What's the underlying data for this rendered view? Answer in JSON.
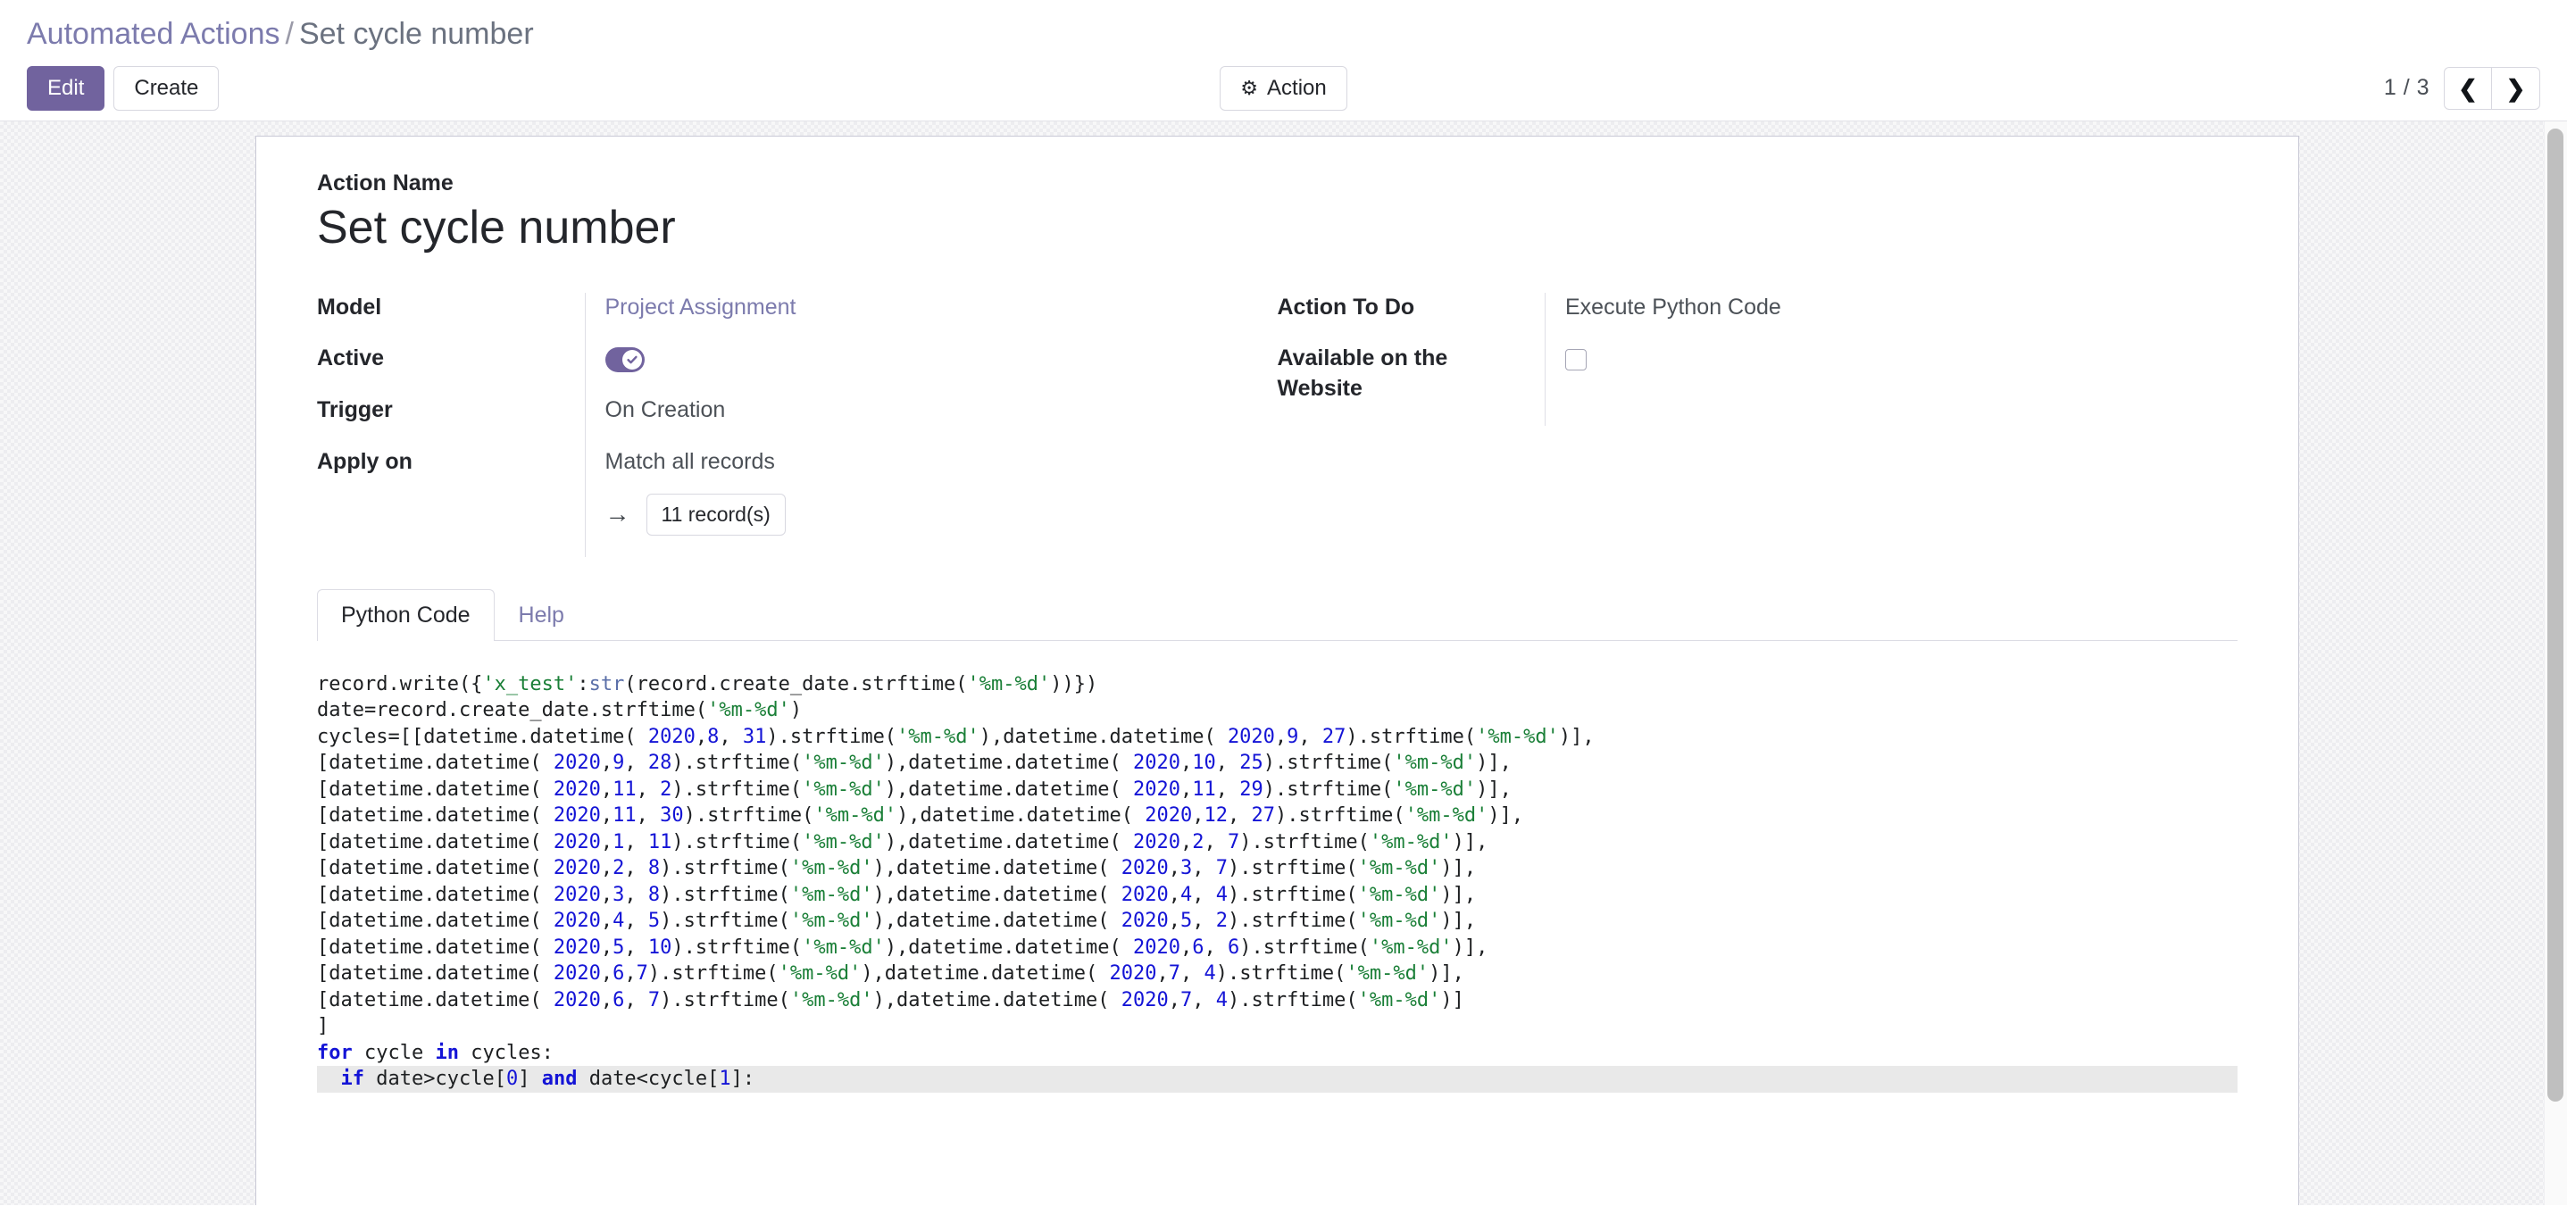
{
  "breadcrumb": {
    "root": "Automated Actions",
    "separator": "/",
    "leaf": "Set cycle number"
  },
  "toolbar": {
    "edit_label": "Edit",
    "create_label": "Create",
    "action_label": "Action",
    "action_icon": "gear-icon"
  },
  "pager": {
    "label": "1 / 3",
    "prev_icon": "❮",
    "next_icon": "❯",
    "current": 1,
    "total": 3
  },
  "form": {
    "name_label": "Action Name",
    "name_value": "Set cycle number",
    "left_fields": [
      {
        "label": "Model",
        "value": "Project Assignment",
        "type": "link"
      },
      {
        "label": "Active",
        "value": "",
        "type": "toggle",
        "checked": true
      },
      {
        "label": "Trigger",
        "value": "On Creation",
        "type": "text"
      },
      {
        "label": "Apply on",
        "value": "Match all records",
        "type": "text"
      }
    ],
    "right_fields": [
      {
        "label": "Action To Do",
        "value": "Execute Python Code",
        "type": "text"
      },
      {
        "label": "Available on the Website",
        "value": "",
        "type": "checkbox",
        "checked": false
      }
    ],
    "records": {
      "arrow_icon": "→",
      "button_label": "11 record(s)",
      "count": 11
    }
  },
  "notebook": {
    "tabs": [
      {
        "label": "Python Code",
        "active": true
      },
      {
        "label": "Help",
        "active": false
      }
    ]
  },
  "code": {
    "language": "python",
    "lines": [
      [
        {
          "t": "record.write({",
          "c": "plain"
        },
        {
          "t": "'x_test'",
          "c": "str"
        },
        {
          "t": ":",
          "c": "plain"
        },
        {
          "t": "str",
          "c": "fn"
        },
        {
          "t": "(record.create_date.strftime(",
          "c": "plain"
        },
        {
          "t": "'%m-%d'",
          "c": "str"
        },
        {
          "t": "))})",
          "c": "plain"
        }
      ],
      [
        {
          "t": "date=record.create_date.strftime(",
          "c": "plain"
        },
        {
          "t": "'%m-%d'",
          "c": "str"
        },
        {
          "t": ")",
          "c": "plain"
        }
      ],
      [
        {
          "t": "cycles=[[datetime.datetime( ",
          "c": "plain"
        },
        {
          "t": "2020",
          "c": "num"
        },
        {
          "t": ",",
          "c": "plain"
        },
        {
          "t": "8",
          "c": "num"
        },
        {
          "t": ", ",
          "c": "plain"
        },
        {
          "t": "31",
          "c": "num"
        },
        {
          "t": ").strftime(",
          "c": "plain"
        },
        {
          "t": "'%m-%d'",
          "c": "str"
        },
        {
          "t": "),datetime.datetime( ",
          "c": "plain"
        },
        {
          "t": "2020",
          "c": "num"
        },
        {
          "t": ",",
          "c": "plain"
        },
        {
          "t": "9",
          "c": "num"
        },
        {
          "t": ", ",
          "c": "plain"
        },
        {
          "t": "27",
          "c": "num"
        },
        {
          "t": ").strftime(",
          "c": "plain"
        },
        {
          "t": "'%m-%d'",
          "c": "str"
        },
        {
          "t": ")],",
          "c": "plain"
        }
      ],
      [
        {
          "t": "[datetime.datetime( ",
          "c": "plain"
        },
        {
          "t": "2020",
          "c": "num"
        },
        {
          "t": ",",
          "c": "plain"
        },
        {
          "t": "9",
          "c": "num"
        },
        {
          "t": ", ",
          "c": "plain"
        },
        {
          "t": "28",
          "c": "num"
        },
        {
          "t": ").strftime(",
          "c": "plain"
        },
        {
          "t": "'%m-%d'",
          "c": "str"
        },
        {
          "t": "),datetime.datetime( ",
          "c": "plain"
        },
        {
          "t": "2020",
          "c": "num"
        },
        {
          "t": ",",
          "c": "plain"
        },
        {
          "t": "10",
          "c": "num"
        },
        {
          "t": ", ",
          "c": "plain"
        },
        {
          "t": "25",
          "c": "num"
        },
        {
          "t": ").strftime(",
          "c": "plain"
        },
        {
          "t": "'%m-%d'",
          "c": "str"
        },
        {
          "t": ")],",
          "c": "plain"
        }
      ],
      [
        {
          "t": "[datetime.datetime( ",
          "c": "plain"
        },
        {
          "t": "2020",
          "c": "num"
        },
        {
          "t": ",",
          "c": "plain"
        },
        {
          "t": "11",
          "c": "num"
        },
        {
          "t": ", ",
          "c": "plain"
        },
        {
          "t": "2",
          "c": "num"
        },
        {
          "t": ").strftime(",
          "c": "plain"
        },
        {
          "t": "'%m-%d'",
          "c": "str"
        },
        {
          "t": "),datetime.datetime( ",
          "c": "plain"
        },
        {
          "t": "2020",
          "c": "num"
        },
        {
          "t": ",",
          "c": "plain"
        },
        {
          "t": "11",
          "c": "num"
        },
        {
          "t": ", ",
          "c": "plain"
        },
        {
          "t": "29",
          "c": "num"
        },
        {
          "t": ").strftime(",
          "c": "plain"
        },
        {
          "t": "'%m-%d'",
          "c": "str"
        },
        {
          "t": ")],",
          "c": "plain"
        }
      ],
      [
        {
          "t": "[datetime.datetime( ",
          "c": "plain"
        },
        {
          "t": "2020",
          "c": "num"
        },
        {
          "t": ",",
          "c": "plain"
        },
        {
          "t": "11",
          "c": "num"
        },
        {
          "t": ", ",
          "c": "plain"
        },
        {
          "t": "30",
          "c": "num"
        },
        {
          "t": ").strftime(",
          "c": "plain"
        },
        {
          "t": "'%m-%d'",
          "c": "str"
        },
        {
          "t": "),datetime.datetime( ",
          "c": "plain"
        },
        {
          "t": "2020",
          "c": "num"
        },
        {
          "t": ",",
          "c": "plain"
        },
        {
          "t": "12",
          "c": "num"
        },
        {
          "t": ", ",
          "c": "plain"
        },
        {
          "t": "27",
          "c": "num"
        },
        {
          "t": ").strftime(",
          "c": "plain"
        },
        {
          "t": "'%m-%d'",
          "c": "str"
        },
        {
          "t": ")],",
          "c": "plain"
        }
      ],
      [
        {
          "t": "[datetime.datetime( ",
          "c": "plain"
        },
        {
          "t": "2020",
          "c": "num"
        },
        {
          "t": ",",
          "c": "plain"
        },
        {
          "t": "1",
          "c": "num"
        },
        {
          "t": ", ",
          "c": "plain"
        },
        {
          "t": "11",
          "c": "num"
        },
        {
          "t": ").strftime(",
          "c": "plain"
        },
        {
          "t": "'%m-%d'",
          "c": "str"
        },
        {
          "t": "),datetime.datetime( ",
          "c": "plain"
        },
        {
          "t": "2020",
          "c": "num"
        },
        {
          "t": ",",
          "c": "plain"
        },
        {
          "t": "2",
          "c": "num"
        },
        {
          "t": ", ",
          "c": "plain"
        },
        {
          "t": "7",
          "c": "num"
        },
        {
          "t": ").strftime(",
          "c": "plain"
        },
        {
          "t": "'%m-%d'",
          "c": "str"
        },
        {
          "t": ")],",
          "c": "plain"
        }
      ],
      [
        {
          "t": "[datetime.datetime( ",
          "c": "plain"
        },
        {
          "t": "2020",
          "c": "num"
        },
        {
          "t": ",",
          "c": "plain"
        },
        {
          "t": "2",
          "c": "num"
        },
        {
          "t": ", ",
          "c": "plain"
        },
        {
          "t": "8",
          "c": "num"
        },
        {
          "t": ").strftime(",
          "c": "plain"
        },
        {
          "t": "'%m-%d'",
          "c": "str"
        },
        {
          "t": "),datetime.datetime( ",
          "c": "plain"
        },
        {
          "t": "2020",
          "c": "num"
        },
        {
          "t": ",",
          "c": "plain"
        },
        {
          "t": "3",
          "c": "num"
        },
        {
          "t": ", ",
          "c": "plain"
        },
        {
          "t": "7",
          "c": "num"
        },
        {
          "t": ").strftime(",
          "c": "plain"
        },
        {
          "t": "'%m-%d'",
          "c": "str"
        },
        {
          "t": ")],",
          "c": "plain"
        }
      ],
      [
        {
          "t": "[datetime.datetime( ",
          "c": "plain"
        },
        {
          "t": "2020",
          "c": "num"
        },
        {
          "t": ",",
          "c": "plain"
        },
        {
          "t": "3",
          "c": "num"
        },
        {
          "t": ", ",
          "c": "plain"
        },
        {
          "t": "8",
          "c": "num"
        },
        {
          "t": ").strftime(",
          "c": "plain"
        },
        {
          "t": "'%m-%d'",
          "c": "str"
        },
        {
          "t": "),datetime.datetime( ",
          "c": "plain"
        },
        {
          "t": "2020",
          "c": "num"
        },
        {
          "t": ",",
          "c": "plain"
        },
        {
          "t": "4",
          "c": "num"
        },
        {
          "t": ", ",
          "c": "plain"
        },
        {
          "t": "4",
          "c": "num"
        },
        {
          "t": ").strftime(",
          "c": "plain"
        },
        {
          "t": "'%m-%d'",
          "c": "str"
        },
        {
          "t": ")],",
          "c": "plain"
        }
      ],
      [
        {
          "t": "[datetime.datetime( ",
          "c": "plain"
        },
        {
          "t": "2020",
          "c": "num"
        },
        {
          "t": ",",
          "c": "plain"
        },
        {
          "t": "4",
          "c": "num"
        },
        {
          "t": ", ",
          "c": "plain"
        },
        {
          "t": "5",
          "c": "num"
        },
        {
          "t": ").strftime(",
          "c": "plain"
        },
        {
          "t": "'%m-%d'",
          "c": "str"
        },
        {
          "t": "),datetime.datetime( ",
          "c": "plain"
        },
        {
          "t": "2020",
          "c": "num"
        },
        {
          "t": ",",
          "c": "plain"
        },
        {
          "t": "5",
          "c": "num"
        },
        {
          "t": ", ",
          "c": "plain"
        },
        {
          "t": "2",
          "c": "num"
        },
        {
          "t": ").strftime(",
          "c": "plain"
        },
        {
          "t": "'%m-%d'",
          "c": "str"
        },
        {
          "t": ")],",
          "c": "plain"
        }
      ],
      [
        {
          "t": "[datetime.datetime( ",
          "c": "plain"
        },
        {
          "t": "2020",
          "c": "num"
        },
        {
          "t": ",",
          "c": "plain"
        },
        {
          "t": "5",
          "c": "num"
        },
        {
          "t": ", ",
          "c": "plain"
        },
        {
          "t": "10",
          "c": "num"
        },
        {
          "t": ").strftime(",
          "c": "plain"
        },
        {
          "t": "'%m-%d'",
          "c": "str"
        },
        {
          "t": "),datetime.datetime( ",
          "c": "plain"
        },
        {
          "t": "2020",
          "c": "num"
        },
        {
          "t": ",",
          "c": "plain"
        },
        {
          "t": "6",
          "c": "num"
        },
        {
          "t": ", ",
          "c": "plain"
        },
        {
          "t": "6",
          "c": "num"
        },
        {
          "t": ").strftime(",
          "c": "plain"
        },
        {
          "t": "'%m-%d'",
          "c": "str"
        },
        {
          "t": ")],",
          "c": "plain"
        }
      ],
      [
        {
          "t": "[datetime.datetime( ",
          "c": "plain"
        },
        {
          "t": "2020",
          "c": "num"
        },
        {
          "t": ",",
          "c": "plain"
        },
        {
          "t": "6",
          "c": "num"
        },
        {
          "t": ",",
          "c": "plain"
        },
        {
          "t": "7",
          "c": "num"
        },
        {
          "t": ").strftime(",
          "c": "plain"
        },
        {
          "t": "'%m-%d'",
          "c": "str"
        },
        {
          "t": "),datetime.datetime( ",
          "c": "plain"
        },
        {
          "t": "2020",
          "c": "num"
        },
        {
          "t": ",",
          "c": "plain"
        },
        {
          "t": "7",
          "c": "num"
        },
        {
          "t": ", ",
          "c": "plain"
        },
        {
          "t": "4",
          "c": "num"
        },
        {
          "t": ").strftime(",
          "c": "plain"
        },
        {
          "t": "'%m-%d'",
          "c": "str"
        },
        {
          "t": ")],",
          "c": "plain"
        }
      ],
      [
        {
          "t": "[datetime.datetime( ",
          "c": "plain"
        },
        {
          "t": "2020",
          "c": "num"
        },
        {
          "t": ",",
          "c": "plain"
        },
        {
          "t": "6",
          "c": "num"
        },
        {
          "t": ", ",
          "c": "plain"
        },
        {
          "t": "7",
          "c": "num"
        },
        {
          "t": ").strftime(",
          "c": "plain"
        },
        {
          "t": "'%m-%d'",
          "c": "str"
        },
        {
          "t": "),datetime.datetime( ",
          "c": "plain"
        },
        {
          "t": "2020",
          "c": "num"
        },
        {
          "t": ",",
          "c": "plain"
        },
        {
          "t": "7",
          "c": "num"
        },
        {
          "t": ", ",
          "c": "plain"
        },
        {
          "t": "4",
          "c": "num"
        },
        {
          "t": ").strftime(",
          "c": "plain"
        },
        {
          "t": "'%m-%d'",
          "c": "str"
        },
        {
          "t": ")]",
          "c": "plain"
        }
      ],
      [
        {
          "t": "]",
          "c": "plain"
        }
      ],
      [
        {
          "t": "for",
          "c": "kw"
        },
        {
          "t": " cycle ",
          "c": "plain"
        },
        {
          "t": "in",
          "c": "kw"
        },
        {
          "t": " cycles:",
          "c": "plain"
        }
      ],
      [
        {
          "t": "  ",
          "c": "plain"
        },
        {
          "t": "if",
          "c": "kw"
        },
        {
          "t": " date>cycle[",
          "c": "plain"
        },
        {
          "t": "0",
          "c": "num"
        },
        {
          "t": "] ",
          "c": "plain"
        },
        {
          "t": "and",
          "c": "kw"
        },
        {
          "t": " date<cycle[",
          "c": "plain"
        },
        {
          "t": "1",
          "c": "num"
        },
        {
          "t": "]:",
          "c": "plain"
        }
      ]
    ],
    "highlight_line_index": 15
  },
  "colors": {
    "brand_purple": "#7c7bad",
    "button_purple": "#71639e",
    "text_dark": "#24262b",
    "string_green": "#1a7f37",
    "number_blue": "#1414d6"
  }
}
